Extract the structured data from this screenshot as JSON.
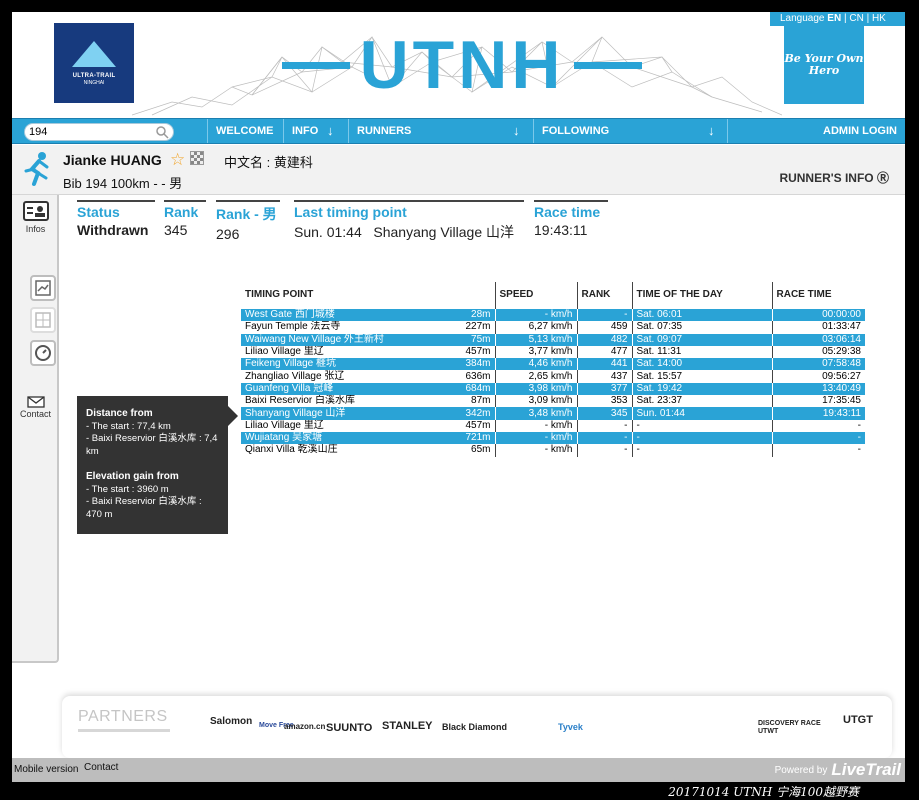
{
  "header": {
    "logo_line1": "ULTRA-TRAIL",
    "logo_line2": "NINGHAI",
    "brand": "UTNH",
    "language_label": "Language",
    "lang_en": "EN",
    "lang_cn": "CN",
    "lang_hk": "HK",
    "slogan": "Be Your Own Hero"
  },
  "nav": {
    "search_value": "194",
    "items": [
      "WELCOME",
      "INFO",
      "RUNNERS",
      "FOLLOWING",
      "ADMIN LOGIN"
    ]
  },
  "runner": {
    "name": "Jianke HUANG",
    "chinese_name": "中文名 : 黄建科",
    "bib_line": "Bib 194   100km - - 男",
    "info_link": "RUNNER'S INFO"
  },
  "sidebar": {
    "infos_label": "Infos",
    "contact_label": "Contact"
  },
  "status": {
    "status_label": "Status",
    "status_value": "Withdrawn",
    "rank_label": "Rank",
    "rank_value": "345",
    "rank_gender_label": "Rank - 男",
    "rank_gender_value": "296",
    "last_label": "Last timing point",
    "last_value": "Sun. 01:44   Shanyang Village 山洋",
    "race_label": "Race time",
    "race_value": "19:43:11"
  },
  "timing": {
    "headers": [
      "TIMING POINT",
      "SPEED",
      "RANK",
      "TIME OF THE DAY",
      "RACE TIME"
    ],
    "rows": [
      {
        "point": "West Gate 西门城楼",
        "dist": "28m",
        "speed": "- km/h",
        "rank": "-",
        "tod": "Sat. 06:01",
        "race": "00:00:00",
        "hl": true
      },
      {
        "point": "Fayun Temple 法云寺",
        "dist": "227m",
        "speed": "6,27 km/h",
        "rank": "459",
        "tod": "Sat. 07:35",
        "race": "01:33:47",
        "hl": false
      },
      {
        "point": "Waiwang New Village 外王新村",
        "dist": "75m",
        "speed": "5,13 km/h",
        "rank": "482",
        "tod": "Sat. 09:07",
        "race": "03:06:14",
        "hl": true
      },
      {
        "point": "Liliao Village 里辽",
        "dist": "457m",
        "speed": "3,77 km/h",
        "rank": "477",
        "tod": "Sat. 11:31",
        "race": "05:29:38",
        "hl": false
      },
      {
        "point": "Feikeng Village 榧坑",
        "dist": "384m",
        "speed": "4,46 km/h",
        "rank": "441",
        "tod": "Sat. 14:00",
        "race": "07:58:48",
        "hl": true
      },
      {
        "point": "Zhangliao Village 张辽",
        "dist": "636m",
        "speed": "2,65 km/h",
        "rank": "437",
        "tod": "Sat. 15:57",
        "race": "09:56:27",
        "hl": false
      },
      {
        "point": "Guanfeng Villa 冠峰",
        "dist": "684m",
        "speed": "3,98 km/h",
        "rank": "377",
        "tod": "Sat. 19:42",
        "race": "13:40:49",
        "hl": true
      },
      {
        "point": "Baixi Reservior 白溪水库",
        "dist": "87m",
        "speed": "3,09 km/h",
        "rank": "353",
        "tod": "Sat. 23:37",
        "race": "17:35:45",
        "hl": false
      },
      {
        "point": "Shanyang Village 山洋",
        "dist": "342m",
        "speed": "3,48 km/h",
        "rank": "345",
        "tod": "Sun. 01:44",
        "race": "19:43:11",
        "hl": true
      },
      {
        "point": "Liliao Village 里辽",
        "dist": "457m",
        "speed": "- km/h",
        "rank": "-",
        "tod": "-",
        "race": "-",
        "hl": false
      },
      {
        "point": "Wujiatang 吴家塘",
        "dist": "721m",
        "speed": "- km/h",
        "rank": "-",
        "tod": "-",
        "race": "-",
        "hl": true
      },
      {
        "point": "Qianxi Villa 乾溪山庄",
        "dist": "65m",
        "speed": "- km/h",
        "rank": "-",
        "tod": "-",
        "race": "-",
        "hl": false
      }
    ]
  },
  "tooltip": {
    "dist_title": "Distance from",
    "dist_start": "- The start : 77,4 km",
    "dist_res": "- Baixi Reservior 白溪水库 : 7,4 km",
    "elev_title": "Elevation gain from",
    "elev_start": "- The start : 3960 m",
    "elev_res": "- Baixi Reservior 白溪水库 : 470 m"
  },
  "partners": {
    "title": "PARTNERS",
    "logos": [
      "Salomon",
      "Move Free",
      "amazon.cn",
      "SUUNTO",
      "STANLEY",
      "Black Diamond",
      "Tyvek",
      "DISCOVERY RACE UTWT",
      "UTGT"
    ]
  },
  "footer": {
    "mobile": "Mobile version",
    "contact": "Contact",
    "powered": "Powered by",
    "livetrail": "LiveTrail"
  },
  "caption": "20171014  UTNH  宁海100越野赛",
  "colors": {
    "accent": "#2aa3d6",
    "dark": "#333333",
    "star": "#f1a52b"
  }
}
